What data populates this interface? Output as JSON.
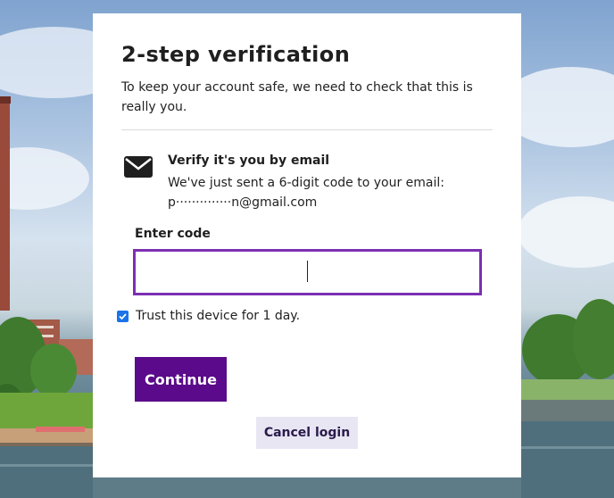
{
  "card": {
    "title": "2-step verification",
    "intro": "To keep your account safe, we need to check that this is re­ally you."
  },
  "method": {
    "icon": "envelope-icon",
    "title": "Verify it's you by email",
    "description": "We've just sent a 6-digit code to your email:",
    "email": "p··············n@gmail.com"
  },
  "code": {
    "label": "Enter code",
    "value": "",
    "placeholder": ""
  },
  "trust": {
    "checked": true,
    "label": "Trust this device for 1 day."
  },
  "buttons": {
    "continue": "Continue",
    "cancel": "Cancel login"
  },
  "colors": {
    "accent": "#7c2fb3",
    "primary_button": "#5a0a8a",
    "secondary_button": "#e8e6f3",
    "checkbox": "#1a73e8"
  }
}
